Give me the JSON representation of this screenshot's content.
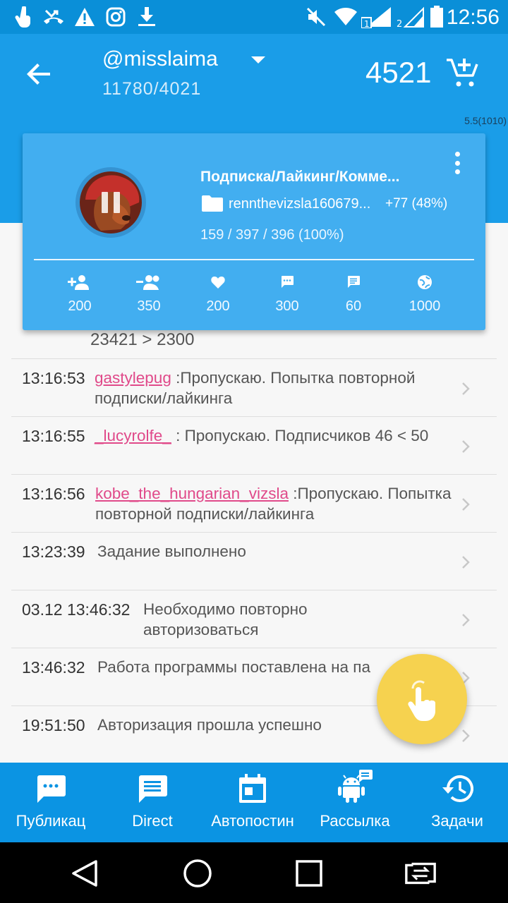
{
  "status_bar": {
    "time": "12:56",
    "icons": [
      "touch-icon",
      "missed-call-icon",
      "warning-icon",
      "instagram-icon",
      "download-icon",
      "mute-icon",
      "wifi-icon",
      "signal-sim1-icon",
      "signal-sim2-icon",
      "battery-icon"
    ]
  },
  "header": {
    "account": "@misslaima",
    "stats": "11780/4021",
    "balance": "4521",
    "version": "5.5(1010)"
  },
  "card": {
    "title": "Подписка/Лайкинг/Комме...",
    "folder": "rennthevizsla160679...",
    "folder_delta": "+77 (48%)",
    "progress": "159 / 397 / 396 (100%)",
    "stats": [
      {
        "icon": "follow-icon",
        "value": "200"
      },
      {
        "icon": "unfollow-icon",
        "value": "350"
      },
      {
        "icon": "like-icon",
        "value": "200"
      },
      {
        "icon": "comment-icon",
        "value": "300"
      },
      {
        "icon": "message-icon",
        "value": "60"
      },
      {
        "icon": "global-icon",
        "value": "1000"
      }
    ]
  },
  "log": {
    "partial": "23421 > 2300",
    "rows": [
      {
        "time": "13:16:53",
        "user": "gastylepug",
        "text": " :Пропускаю. Попытка повторной подписки/лайкинга"
      },
      {
        "time": "13:16:55",
        "user": "_lucyrolfe_",
        "text": " : Пропускаю. Подписчиков 46 < 50"
      },
      {
        "time": "13:16:56",
        "user": "kobe_the_hungarian_vizsla",
        "text": " :Пропускаю. Попытка повторной подписки/лайкинга"
      },
      {
        "time": "13:23:39",
        "user": "",
        "text": "Задание выполнено"
      },
      {
        "time": "03.12 13:46:32",
        "user": "",
        "text": "Необходимо повторно авторизоваться"
      },
      {
        "time": "13:46:32",
        "user": "",
        "text": "Работа программы поставлена на па"
      },
      {
        "time": "19:51:50",
        "user": "",
        "text": "Авторизация прошла успешно"
      }
    ]
  },
  "bottom_nav": [
    {
      "label": "Публикац",
      "icon": "chat-dots-icon"
    },
    {
      "label": "Direct",
      "icon": "message-lines-icon"
    },
    {
      "label": "Автопостин",
      "icon": "calendar-icon"
    },
    {
      "label": "Рассылка",
      "icon": "android-message-icon"
    },
    {
      "label": "Задачи",
      "icon": "history-icon"
    }
  ],
  "colors": {
    "primary": "#1a9de8",
    "status_bar": "#0a8fd8",
    "card": "#42aef0",
    "username": "#e04a8a",
    "fab": "#f6d24f"
  }
}
